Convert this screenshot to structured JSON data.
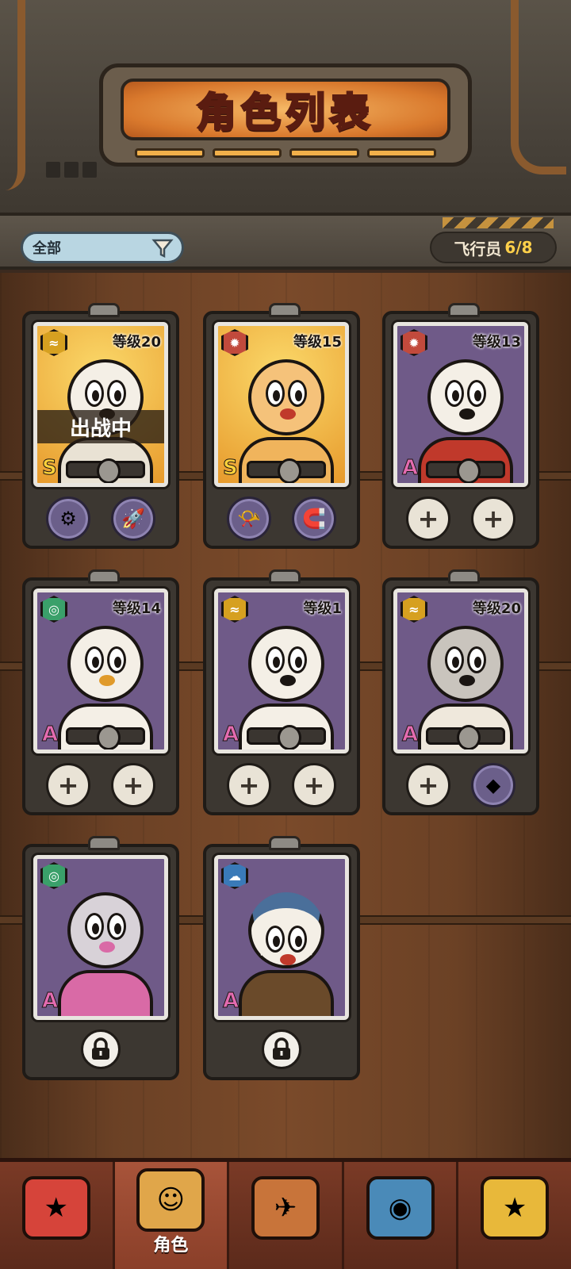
{
  "header": {
    "title": "角色列表"
  },
  "filter": {
    "label": "全部",
    "pilots_label": "飞行员",
    "pilots_count": "6/8"
  },
  "cards": [
    {
      "level": "等级20",
      "rank": "S",
      "status": "出战中",
      "element_icon": "wind-icon"
    },
    {
      "level": "等级15",
      "rank": "S",
      "element_icon": "gear-icon"
    },
    {
      "level": "等级13",
      "rank": "A",
      "element_icon": "gear-icon"
    },
    {
      "level": "等级14",
      "rank": "A",
      "element_icon": "swirl-icon"
    },
    {
      "level": "等级1",
      "rank": "A",
      "element_icon": "wind-icon"
    },
    {
      "level": "等级20",
      "rank": "A",
      "element_icon": "wind-icon"
    },
    {
      "rank": "A",
      "element_icon": "swirl-icon"
    },
    {
      "rank": "A",
      "element_icon": "rain-cloud-icon"
    }
  ],
  "slot_symbol": "+",
  "nav": {
    "active_label": "角色"
  }
}
